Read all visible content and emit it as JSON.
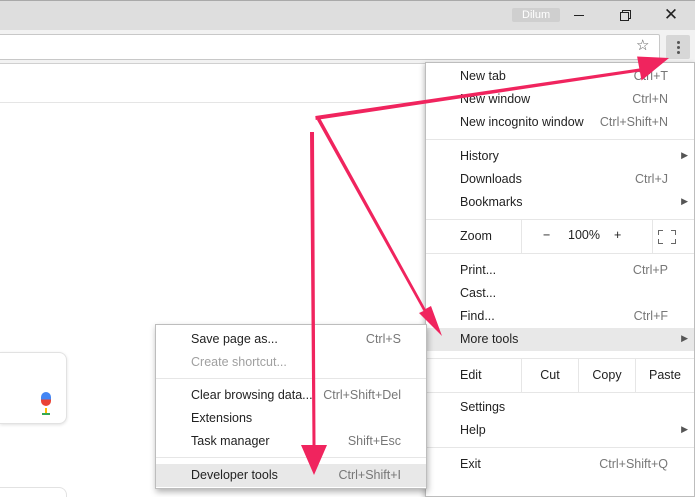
{
  "window": {
    "profile_name": "Dilum"
  },
  "main_menu": {
    "new_tab": {
      "label": "New tab",
      "shortcut": "Ctrl+T"
    },
    "new_window": {
      "label": "New window",
      "shortcut": "Ctrl+N"
    },
    "new_incognito": {
      "label": "New incognito window",
      "shortcut": "Ctrl+Shift+N"
    },
    "history": {
      "label": "History"
    },
    "downloads": {
      "label": "Downloads",
      "shortcut": "Ctrl+J"
    },
    "bookmarks": {
      "label": "Bookmarks"
    },
    "zoom": {
      "label": "Zoom",
      "minus": "−",
      "value": "100%",
      "plus": "+"
    },
    "print": {
      "label": "Print...",
      "shortcut": "Ctrl+P"
    },
    "cast": {
      "label": "Cast..."
    },
    "find": {
      "label": "Find...",
      "shortcut": "Ctrl+F"
    },
    "more_tools": {
      "label": "More tools"
    },
    "edit": {
      "label": "Edit",
      "cut": "Cut",
      "copy": "Copy",
      "paste": "Paste"
    },
    "settings": {
      "label": "Settings"
    },
    "help": {
      "label": "Help"
    },
    "exit": {
      "label": "Exit",
      "shortcut": "Ctrl+Shift+Q"
    }
  },
  "more_tools_menu": {
    "save_page": {
      "label": "Save page as...",
      "shortcut": "Ctrl+S"
    },
    "create_shortcut": {
      "label": "Create shortcut..."
    },
    "clear_data": {
      "label": "Clear browsing data...",
      "shortcut": "Ctrl+Shift+Del"
    },
    "extensions": {
      "label": "Extensions"
    },
    "task_manager": {
      "label": "Task manager",
      "shortcut": "Shift+Esc"
    },
    "developer_tools": {
      "label": "Developer tools",
      "shortcut": "Ctrl+Shift+I"
    }
  },
  "colors": {
    "annotation_arrow": "#f0245e",
    "highlight": "#e8e8e8"
  },
  "icons": [
    "minimize-icon",
    "restore-icon",
    "close-icon",
    "star-icon",
    "kebab-menu-icon",
    "fullscreen-icon",
    "chevron-right-icon",
    "microphone-icon"
  ]
}
